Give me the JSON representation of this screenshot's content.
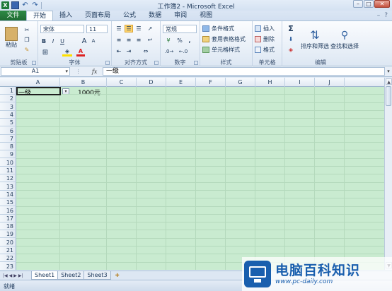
{
  "window": {
    "title": "工作簿2 - Microsoft Excel",
    "minimize": "–",
    "restore": "□",
    "close": "✕"
  },
  "qat": {
    "logo": "X",
    "undo": "↶",
    "redo": "↷"
  },
  "tabs": {
    "file": "文件",
    "items": [
      "开始",
      "插入",
      "页面布局",
      "公式",
      "数据",
      "审阅",
      "视图"
    ],
    "active": "开始",
    "right_help": "?",
    "right_min": "–"
  },
  "ribbon": {
    "clipboard": {
      "label": "剪贴板",
      "paste": "粘贴"
    },
    "font": {
      "label": "字体",
      "name": "宋体",
      "size": "11",
      "bold": "B",
      "italic": "I",
      "underline": "U",
      "grow": "A",
      "shrink": "A",
      "color": "A"
    },
    "alignment": {
      "label": "对齐方式"
    },
    "number": {
      "label": "数字",
      "format": "常规",
      "percent": "%",
      "comma": ","
    },
    "styles": {
      "label": "样式",
      "conditional": "条件格式",
      "table": "套用表格格式",
      "cell": "单元格样式"
    },
    "cells": {
      "label": "单元格",
      "insert": "插入",
      "delete": "删除",
      "format": "格式"
    },
    "editing": {
      "label": "编辑",
      "sum": "Σ",
      "sort": "排序和筛选",
      "find": "查找和选择"
    }
  },
  "formula_bar": {
    "name_box": "A1",
    "fx": "fx",
    "content": "一级"
  },
  "columns": [
    "A",
    "B",
    "C",
    "D",
    "E",
    "F",
    "G",
    "H",
    "I",
    "J"
  ],
  "rows": [
    "1",
    "2",
    "3",
    "4",
    "5",
    "6",
    "7",
    "8",
    "9",
    "10",
    "11",
    "12",
    "13",
    "14",
    "15",
    "16",
    "17",
    "18",
    "19",
    "20",
    "21",
    "22",
    "23"
  ],
  "cells": {
    "A1": "一级",
    "B1": "1000元"
  },
  "sheets": [
    "Sheet1",
    "Sheet2",
    "Sheet3"
  ],
  "active_sheet": "Sheet1",
  "status": {
    "ready": "就绪"
  },
  "watermark": {
    "text": "电脑百科知识",
    "url": "www.pc-daily.com"
  },
  "colors": {
    "grid_bg": "#c9ebd0",
    "file_tab": "#1f6b33",
    "accent": "#1a5fae"
  }
}
